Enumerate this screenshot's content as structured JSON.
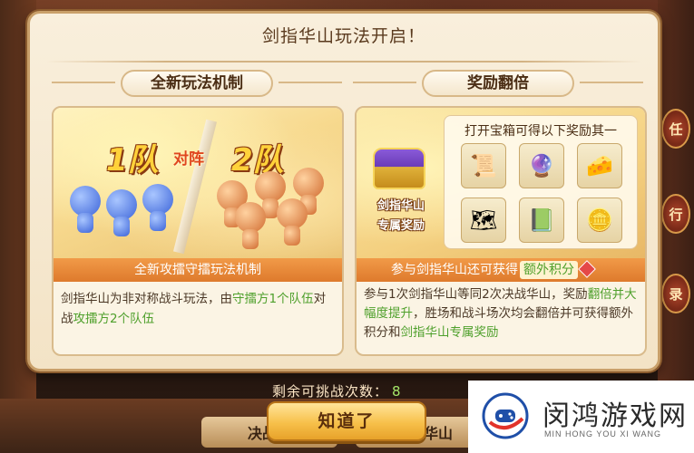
{
  "background": {
    "side_tabs": [
      "任",
      "行",
      "录"
    ],
    "bottom_buttons": [
      "决战中",
      "剑指华山"
    ],
    "remaining_label": "剩余可挑战次数：",
    "remaining_count": "8"
  },
  "dialog": {
    "title": "剑指华山玩法开启！",
    "left": {
      "header": "全新玩法机制",
      "team_one": "1队",
      "versus": "对阵",
      "team_two": "2队",
      "caption": "全新攻擂守擂玩法机制",
      "desc_part1": "剑指华山为非对称战斗玩法，由",
      "desc_hl1": "守擂方1个队伍",
      "desc_part2": "对战",
      "desc_hl2": "攻擂方2个队伍"
    },
    "right": {
      "header": "奖励翻倍",
      "chest_label_line1": "剑指华山",
      "chest_label_line2": "专属奖励",
      "reward_title": "打开宝箱可得以下奖励其一",
      "rewards": [
        {
          "icon": "scroll-icon",
          "glyph": "📜"
        },
        {
          "icon": "blue-orb-icon",
          "glyph": "🔮"
        },
        {
          "icon": "gold-ingot-icon",
          "glyph": "🧀"
        },
        {
          "icon": "map-scroll-icon",
          "glyph": "🗺"
        },
        {
          "icon": "skill-book-icon",
          "glyph": "📗"
        },
        {
          "icon": "gold-coin-icon",
          "glyph": "🪙"
        }
      ],
      "caption_text": "参与剑指华山还可获得",
      "caption_hl": "额外积分",
      "desc_part1": "参与1次剑指华山等同2次决战华山，奖励",
      "desc_hl1": "翻倍并大幅度提升",
      "desc_part2": "，胜场和战斗场次均会翻倍并可获得额外积分和",
      "desc_hl2": "剑指华山专属奖励"
    },
    "confirm_label": "知道了"
  },
  "watermark": {
    "title": "闵鸿游戏网",
    "subtitle": "MIN HONG YOU XI WANG"
  },
  "colors": {
    "highlight_green": "#4fa02c",
    "caption_orange": "#de7a2c",
    "button_gold": "#f7c04a"
  }
}
